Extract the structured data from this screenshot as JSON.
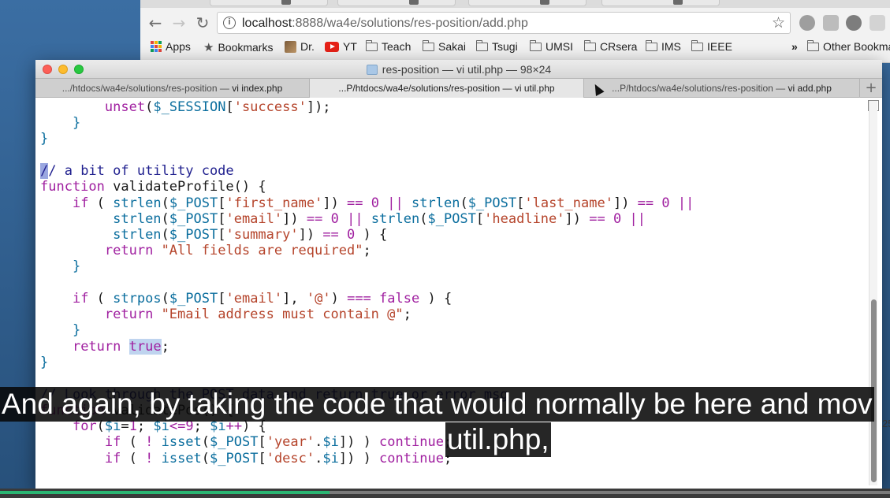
{
  "browser": {
    "url_host": "localhost",
    "url_path": ":8888/wa4e/solutions/res-position/add.php",
    "bookmarks": [
      {
        "label": "Apps",
        "icon": "apps-icon"
      },
      {
        "label": "Bookmarks",
        "icon": "star-icon"
      },
      {
        "label": "Dr.",
        "icon": "avatar-icon"
      },
      {
        "label": "YT",
        "icon": "youtube-icon"
      },
      {
        "label": "Teach",
        "icon": "folder-icon"
      },
      {
        "label": "Sakai",
        "icon": "folder-icon"
      },
      {
        "label": "Tsugi",
        "icon": "folder-icon"
      },
      {
        "label": "UMSI",
        "icon": "folder-icon"
      },
      {
        "label": "CRsera",
        "icon": "folder-icon"
      },
      {
        "label": "IMS",
        "icon": "folder-icon"
      },
      {
        "label": "IEEE",
        "icon": "folder-icon"
      }
    ],
    "overflow_label": "»",
    "other_bookmarks": "Other Bookma"
  },
  "terminal": {
    "title": "res-position — vi util.php — 98×24",
    "tabs": [
      {
        "prefix": "...",
        "dir": "/htdocs/wa4e/solutions/res-position — ",
        "cmd": "vi index.php"
      },
      {
        "prefix": "...",
        "dir": "P/htdocs/wa4e/solutions/res-position — ",
        "cmd": "vi util.php"
      },
      {
        "prefix": "...",
        "dir": "P/htdocs/wa4e/solutions/res-position — ",
        "cmd": "vi add.php"
      }
    ],
    "add_tab": "+",
    "code_lines": [
      "        unset($_SESSION['success']);",
      "    }",
      "}",
      "",
      "// a bit of utility code",
      "function validateProfile() {",
      "    if ( strlen($_POST['first_name']) == 0 || strlen($_POST['last_name']) == 0 ||",
      "         strlen($_POST['email']) == 0 || strlen($_POST['headline']) == 0 ||",
      "         strlen($_POST['summary']) == 0 ) {",
      "        return \"All fields are required\";",
      "    }",
      "",
      "    if ( strpos($_POST['email'], '@') === false ) {",
      "        return \"Email address must contain @\";",
      "    }",
      "    return true;",
      "}",
      "",
      "// Look through the POST data and return true or error msg",
      "function validatePos() {",
      "    for($i=1; $i<=9; $i++) {",
      "        if ( ! isset($_POST['year'.$i]) ) continue;",
      "        if ( ! isset($_POST['desc'.$i]) ) continue;"
    ],
    "edge_number": "25"
  },
  "captions": {
    "line1": "And again, by taking the code that would normally be here and mov",
    "line2": "util.php,"
  },
  "video_progress": 0.37,
  "colors": {
    "keyword": "#a020a0",
    "variable": "#0b6e9e",
    "string": "#b5442b",
    "comment": "#21218f",
    "progress": "#2bb673"
  }
}
